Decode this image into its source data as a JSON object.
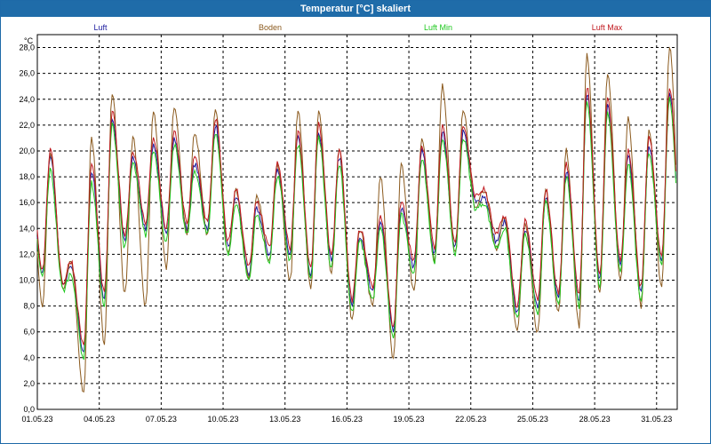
{
  "window": {
    "title": "Temperatur [°C] skaliert"
  },
  "colors": {
    "luft": "#1c1c9e",
    "boden": "#8b5a1e",
    "luft_min": "#1ec81e",
    "luft_max": "#c0181e",
    "grid": "#000000",
    "axis": "#000000"
  },
  "chart_data": {
    "type": "line",
    "ylabel": "°C",
    "ylim": [
      0,
      29
    ],
    "yticks": [
      "0,0",
      "2,0",
      "4,0",
      "6,0",
      "8,0",
      "10,0",
      "12,0",
      "14,0",
      "16,0",
      "18,0",
      "20,0",
      "22,0",
      "24,0",
      "26,0",
      "28,0"
    ],
    "xlabels": [
      "01.05.23",
      "04.05.23",
      "07.05.23",
      "10.05.23",
      "13.05.23",
      "16.05.23",
      "19.05.23",
      "22.05.23",
      "25.05.23",
      "28.05.23",
      "31.05.23"
    ],
    "grid": true,
    "legend_position": "top",
    "days": [
      "01.05.23",
      "02.05.23",
      "03.05.23",
      "04.05.23",
      "05.05.23",
      "06.05.23",
      "07.05.23",
      "08.05.23",
      "09.05.23",
      "10.05.23",
      "11.05.23",
      "12.05.23",
      "13.05.23",
      "14.05.23",
      "15.05.23",
      "16.05.23",
      "17.05.23",
      "18.05.23",
      "19.05.23",
      "20.05.23",
      "21.05.23",
      "22.05.23",
      "23.05.23",
      "24.05.23",
      "25.05.23",
      "26.05.23",
      "27.05.23",
      "28.05.23",
      "29.05.23",
      "30.05.23",
      "31.05.23"
    ],
    "series": [
      {
        "name": "Luft",
        "color": "#1c1c9e",
        "daily_min": [
          10.5,
          9.5,
          4.5,
          8.5,
          13.0,
          14.0,
          13.5,
          14.0,
          14.0,
          12.5,
          10.5,
          12.0,
          12.0,
          10.5,
          11.5,
          8.0,
          9.0,
          6.0,
          11.0,
          12.0,
          12.5,
          16.0,
          13.0,
          7.5,
          8.0,
          8.5,
          8.5,
          10.0,
          11.0,
          9.0,
          11.5
        ],
        "daily_max": [
          19.5,
          11.0,
          18.5,
          22.5,
          19.5,
          20.5,
          21.0,
          19.0,
          22.0,
          16.5,
          15.5,
          18.5,
          21.0,
          21.5,
          19.5,
          13.5,
          14.5,
          15.5,
          20.0,
          21.5,
          21.5,
          16.5,
          14.5,
          14.0,
          16.5,
          18.5,
          24.5,
          23.5,
          19.5,
          20.5,
          24.5
        ]
      },
      {
        "name": "Boden",
        "color": "#8b5a1e",
        "daily_min": [
          8.0,
          9.5,
          1.3,
          5.2,
          9.0,
          8.0,
          11.0,
          13.5,
          13.5,
          12.0,
          10.0,
          11.5,
          10.0,
          9.5,
          10.5,
          7.0,
          8.0,
          4.0,
          9.0,
          11.5,
          12.0,
          15.5,
          12.5,
          6.0,
          6.0,
          7.5,
          6.5,
          9.0,
          10.0,
          8.0,
          9.5
        ],
        "daily_max": [
          20.0,
          11.5,
          21.0,
          24.5,
          21.0,
          23.0,
          23.5,
          21.5,
          23.0,
          17.0,
          16.5,
          19.0,
          23.0,
          23.0,
          20.0,
          14.0,
          18.0,
          19.0,
          21.0,
          25.0,
          23.0,
          17.0,
          15.0,
          14.5,
          17.0,
          20.0,
          27.5,
          26.0,
          22.5,
          21.5,
          28.0
        ]
      },
      {
        "name": "Luft Min",
        "color": "#1ec81e",
        "daily_min": [
          10.2,
          9.2,
          4.0,
          8.0,
          12.5,
          13.5,
          13.0,
          13.5,
          13.5,
          12.0,
          10.0,
          11.5,
          11.5,
          10.0,
          11.0,
          7.5,
          8.5,
          5.5,
          10.5,
          11.5,
          12.0,
          15.5,
          12.5,
          7.0,
          7.5,
          8.0,
          8.0,
          9.5,
          10.5,
          8.5,
          11.0
        ],
        "daily_max": [
          18.5,
          10.5,
          17.5,
          22.0,
          19.0,
          20.0,
          20.5,
          18.5,
          21.5,
          16.0,
          15.0,
          18.0,
          20.5,
          21.0,
          19.0,
          13.0,
          14.0,
          15.0,
          19.5,
          21.0,
          21.0,
          16.0,
          14.0,
          13.5,
          16.0,
          18.0,
          24.0,
          23.0,
          19.0,
          20.0,
          24.0
        ]
      },
      {
        "name": "Luft Max",
        "color": "#c0181e",
        "daily_min": [
          10.8,
          9.8,
          5.0,
          9.0,
          13.5,
          14.5,
          14.0,
          14.5,
          14.5,
          13.0,
          11.0,
          12.5,
          12.5,
          11.0,
          12.0,
          8.5,
          9.5,
          6.5,
          11.5,
          12.5,
          13.0,
          16.5,
          13.5,
          8.0,
          8.5,
          9.0,
          9.0,
          10.5,
          11.5,
          9.5,
          12.0
        ],
        "daily_max": [
          20.0,
          11.5,
          19.0,
          23.0,
          20.0,
          21.0,
          21.5,
          19.5,
          22.5,
          17.0,
          16.0,
          19.0,
          21.5,
          22.0,
          20.0,
          14.0,
          15.0,
          16.0,
          20.5,
          22.0,
          22.0,
          17.0,
          15.0,
          14.5,
          17.0,
          19.0,
          25.0,
          24.0,
          20.0,
          21.0,
          25.0
        ]
      }
    ]
  }
}
